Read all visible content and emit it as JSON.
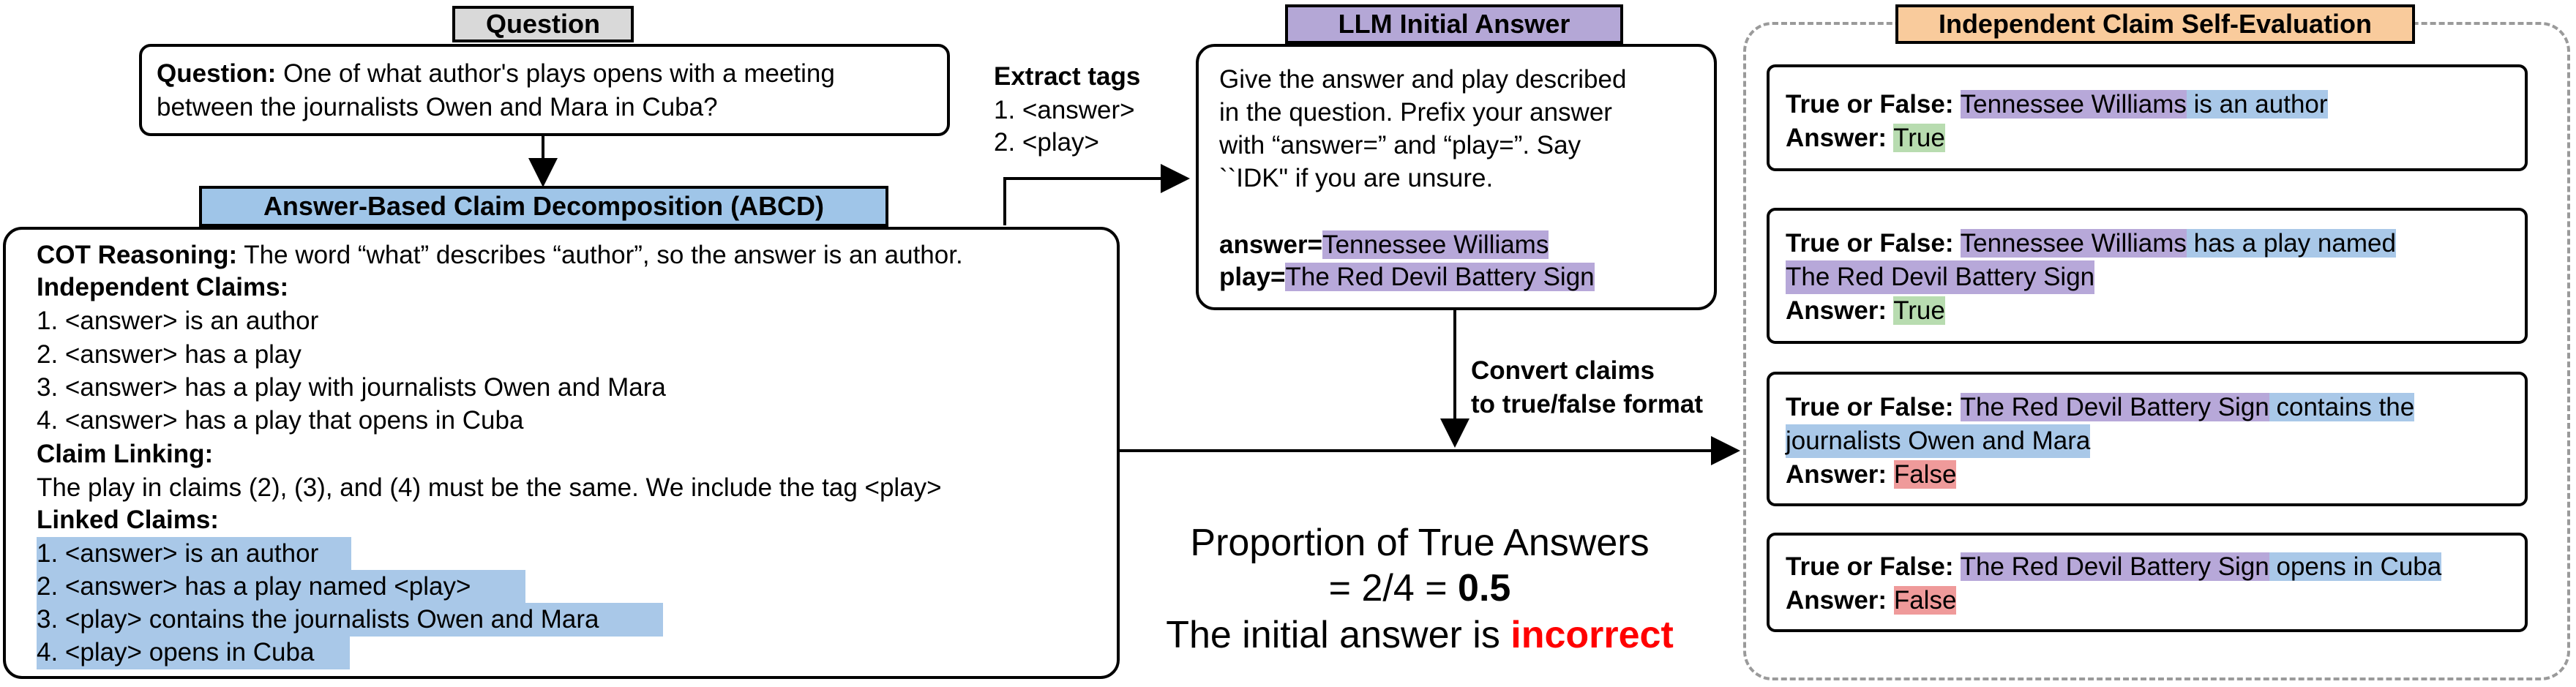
{
  "question": {
    "label": "Question",
    "prefix": "Question:",
    "line1": "One of what author's plays opens with a meeting",
    "line2": "between the journalists Owen and Mara in Cuba?"
  },
  "abcd": {
    "label": "Answer-Based Claim Decomposition (ABCD)",
    "cot_prefix": "COT Reasoning:",
    "cot_text": "The word “what” describes “author”, so the answer is an author.",
    "independent_heading": "Independent Claims:",
    "independent_claims": [
      "1. <answer> is an author",
      "2. <answer> has a play",
      "3. <answer> has a play with journalists Owen and Mara",
      "4. <answer> has a play that opens in Cuba"
    ],
    "linking_heading": "Claim Linking:",
    "linking_text": "The play in claims (2), (3), and (4) must be the same. We include the tag <play>",
    "linked_heading": "Linked Claims:",
    "linked_claims": [
      "1. <answer> is an author",
      "2. <answer> has a play named <play>",
      "3. <play> contains the journalists Owen and Mara",
      "4. <play> opens in Cuba"
    ]
  },
  "extract": {
    "heading": "Extract tags",
    "items": [
      "1. <answer>",
      "2. <play>"
    ]
  },
  "llm": {
    "label": "LLM Initial Answer",
    "prompt_lines": [
      "Give the answer and play described",
      "in the question. Prefix your answer",
      "with “answer=” and “play=”. Say",
      "``IDK\" if you are unsure."
    ],
    "answer_prefix": "answer=",
    "answer_value": "Tennessee Williams",
    "play_prefix": "play=",
    "play_value": "The Red Devil Battery Sign"
  },
  "convert": {
    "line1": "Convert claims",
    "line2": "to true/false format"
  },
  "result": {
    "line1": "Proportion of True Answers",
    "line2_prefix": "= 2/4 = ",
    "line2_value": "0.5",
    "line3_prefix": "The initial answer is ",
    "line3_value": "incorrect"
  },
  "evaluation": {
    "label": "Independent Claim Self-Evaluation",
    "tf_label": "True or False:",
    "answer_label": "Answer:",
    "claims": [
      {
        "entity": "Tennessee Williams",
        "text": " is an author",
        "text2": "",
        "answer": "True"
      },
      {
        "entity": "Tennessee Williams",
        "text": " has a play named",
        "text2": "The Red Devil Battery Sign",
        "answer": "True"
      },
      {
        "entity": "The Red Devil Battery Sign",
        "text": " contains the",
        "text2": "journalists Owen and Mara",
        "answer": "False"
      },
      {
        "entity": "The Red Devil Battery Sign",
        "text": " opens in Cuba",
        "text2": "",
        "answer": "False"
      }
    ]
  },
  "colors": {
    "claim_blue": "#a9c8e8",
    "entity_purple": "#b7a8d9",
    "true_green": "#b8dcb0",
    "false_red": "#ef9a9a",
    "question_label": "#d9d9d9",
    "abcd_label": "#9fc5e8",
    "llm_label": "#b4a7d6",
    "eval_label": "#f9cb9c",
    "incorrect": "#ff0000"
  }
}
